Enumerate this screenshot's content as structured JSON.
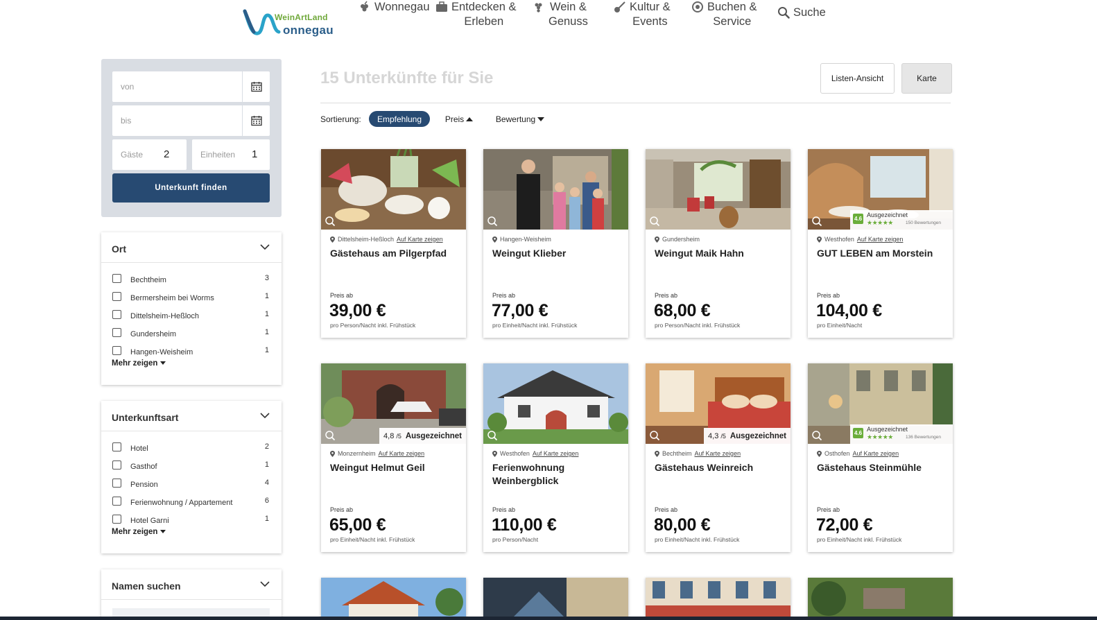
{
  "header": {
    "logo_line1": "WeinArtLand",
    "logo_line2": "onnegau",
    "nav": [
      {
        "label1": "Wonnegau",
        "label2": "",
        "icon": "grape-icon"
      },
      {
        "label1": "Entdecken &",
        "label2": "Erleben",
        "icon": "suitcase-icon"
      },
      {
        "label1": "Wein &",
        "label2": "Genuss",
        "icon": "grapes-icon"
      },
      {
        "label1": "Kultur &",
        "label2": "Events",
        "icon": "guitar-icon"
      },
      {
        "label1": "Buchen &",
        "label2": "Service",
        "icon": "support-icon"
      }
    ],
    "search_label": "Suche"
  },
  "search_form": {
    "from_placeholder": "von",
    "to_placeholder": "bis",
    "guests_label": "Gäste",
    "guests_value": "2",
    "units_label": "Einheiten",
    "units_value": "1",
    "submit_label": "Unterkunft finden"
  },
  "filters": {
    "ort": {
      "title": "Ort",
      "items": [
        {
          "label": "Bechtheim",
          "count": "3"
        },
        {
          "label": "Bermersheim bei Worms",
          "count": "1"
        },
        {
          "label": "Dittelsheim-Heßloch",
          "count": "1"
        },
        {
          "label": "Gundersheim",
          "count": "1"
        },
        {
          "label": "Hangen-Weisheim",
          "count": "1"
        }
      ],
      "more_label": "Mehr zeigen"
    },
    "type": {
      "title": "Unterkunftsart",
      "items": [
        {
          "label": "Hotel",
          "count": "2"
        },
        {
          "label": "Gasthof",
          "count": "1"
        },
        {
          "label": "Pension",
          "count": "4"
        },
        {
          "label": "Ferienwohnung / Appartement",
          "count": "6"
        },
        {
          "label": "Hotel Garni",
          "count": "1"
        }
      ],
      "more_label": "Mehr zeigen"
    },
    "name": {
      "title": "Namen suchen"
    }
  },
  "results": {
    "title": "15 Unterkünfte für Sie",
    "list_view_label": "Listen-Ansicht",
    "map_view_label": "Karte",
    "sort_label": "Sortierung:",
    "sort_options": [
      "Empfehlung",
      "Preis",
      "Bewertung"
    ]
  },
  "listings": [
    {
      "location": "Dittelsheim-Heßloch",
      "map_link": "Auf Karte zeigen",
      "name": "Gästehaus am Pilgerpfad",
      "price_from": "Preis ab",
      "price": "39,00 €",
      "note": "pro Person/Nacht inkl. Frühstück",
      "badge": "none"
    },
    {
      "location": "Hangen-Weisheim",
      "map_link": "",
      "name": "Weingut Klieber",
      "price_from": "Preis ab",
      "price": "77,00 €",
      "note": "pro Einheit/Nacht inkl. Frühstück",
      "badge": "none"
    },
    {
      "location": "Gundersheim",
      "map_link": "",
      "name": "Weingut Maik Hahn",
      "price_from": "Preis ab",
      "price": "68,00 €",
      "note": "pro Person/Nacht inkl. Frühstück",
      "badge": "none"
    },
    {
      "location": "Westhofen",
      "map_link": "Auf Karte zeigen",
      "name": "GUT LEBEN am Morstein",
      "price_from": "Preis ab",
      "price": "104,00 €",
      "note": "pro Einheit/Nacht",
      "badge": "award",
      "award_score": "4.6",
      "award_title": "Ausgezeichnet",
      "award_reviews": "150 Bewertungen"
    },
    {
      "location": "Monzernheim",
      "map_link": "Auf Karte zeigen",
      "name": "Weingut Helmut Geil",
      "price_from": "Preis ab",
      "price": "65,00 €",
      "note": "pro Einheit/Nacht inkl. Frühstück",
      "badge": "rating",
      "rating": "4,8",
      "rating_max": "/5",
      "rating_text": "Ausgezeichnet"
    },
    {
      "location": "Westhofen",
      "map_link": "Auf Karte zeigen",
      "name": "Ferienwohnung Weinbergblick",
      "price_from": "Preis ab",
      "price": "110,00 €",
      "note": "pro Person/Nacht",
      "badge": "none"
    },
    {
      "location": "Bechtheim",
      "map_link": "Auf Karte zeigen",
      "name": "Gästehaus Weinreich",
      "price_from": "Preis ab",
      "price": "80,00 €",
      "note": "pro Einheit/Nacht inkl. Frühstück",
      "badge": "rating",
      "rating": "4,3",
      "rating_max": "/5",
      "rating_text": "Ausgezeichnet"
    },
    {
      "location": "Osthofen",
      "map_link": "Auf Karte zeigen",
      "name": "Gästehaus Steinmühle",
      "price_from": "Preis ab",
      "price": "72,00 €",
      "note": "pro Einheit/Nacht inkl. Frühstück",
      "badge": "award",
      "award_score": "4.6",
      "award_title": "Ausgezeichnet",
      "award_reviews": "136 Bewertungen"
    }
  ],
  "colors": {
    "brand_dark": "#274a72",
    "brand_green": "#6aad3a",
    "sidebar_bg": "#d9dde3"
  }
}
